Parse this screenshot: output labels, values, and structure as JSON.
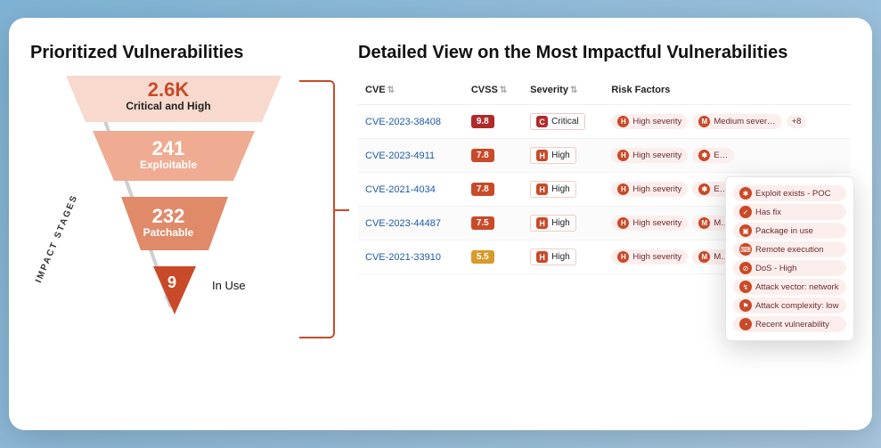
{
  "left": {
    "title": "Prioritized Vulnerabilities",
    "impact_label": "IMPACT STAGES",
    "stages": [
      {
        "value": "2.6K",
        "label": "Critical and High"
      },
      {
        "value": "241",
        "label": "Exploitable"
      },
      {
        "value": "232",
        "label": "Patchable"
      },
      {
        "value": "9",
        "label": "In Use"
      }
    ]
  },
  "right": {
    "title": "Detailed View on the Most Impactful Vulnerabilities",
    "columns": {
      "cve": "CVE",
      "cvss": "CVSS",
      "severity": "Severity",
      "risk": "Risk Factors"
    },
    "rows": [
      {
        "cve": "CVE-2023-38408",
        "cvss": "9.8",
        "cvss_color": "#b02a2a",
        "sev_code": "C",
        "sev_label": "Critical",
        "sev_bg": "#b02a2a",
        "sev_border": "#eac9c9",
        "r1_code": "H",
        "r1_label": "High severity",
        "r2_code": "M",
        "r2_label": "Medium sever…",
        "more": "+8"
      },
      {
        "cve": "CVE-2023-4911",
        "cvss": "7.8",
        "cvss_color": "#c94a28",
        "sev_code": "H",
        "sev_label": "High",
        "sev_bg": "#c94a28",
        "sev_border": "#f0cfc4",
        "r1_code": "H",
        "r1_label": "High severity",
        "r2_code": "",
        "r2_label": "E…",
        "more": ""
      },
      {
        "cve": "CVE-2021-4034",
        "cvss": "7.8",
        "cvss_color": "#c94a28",
        "sev_code": "H",
        "sev_label": "High",
        "sev_bg": "#c94a28",
        "sev_border": "#f0cfc4",
        "r1_code": "H",
        "r1_label": "High severity",
        "r2_code": "",
        "r2_label": "E…",
        "more": ""
      },
      {
        "cve": "CVE-2023-44487",
        "cvss": "7.5",
        "cvss_color": "#c94a28",
        "sev_code": "H",
        "sev_label": "High",
        "sev_bg": "#c94a28",
        "sev_border": "#f0cfc4",
        "r1_code": "H",
        "r1_label": "High severity",
        "r2_code": "M",
        "r2_label": "M…",
        "more": ""
      },
      {
        "cve": "CVE-2021-33910",
        "cvss": "5.5",
        "cvss_color": "#d89a2b",
        "sev_code": "H",
        "sev_label": "High",
        "sev_bg": "#c94a28",
        "sev_border": "#f0cfc4",
        "r1_code": "H",
        "r1_label": "High severity",
        "r2_code": "M",
        "r2_label": "M…",
        "more": ""
      }
    ],
    "popover": [
      {
        "icon": "✱",
        "label": "Exploit exists - POC"
      },
      {
        "icon": "✓",
        "label": "Has fix"
      },
      {
        "icon": "▣",
        "label": "Package in use"
      },
      {
        "icon": "⌨",
        "label": "Remote execution"
      },
      {
        "icon": "⊘",
        "label": "DoS - High"
      },
      {
        "icon": "↯",
        "label": "Attack vector: network"
      },
      {
        "icon": "⚑",
        "label": "Attack complexity: low"
      },
      {
        "icon": "◔",
        "label": "Recent vulnerability"
      }
    ]
  }
}
